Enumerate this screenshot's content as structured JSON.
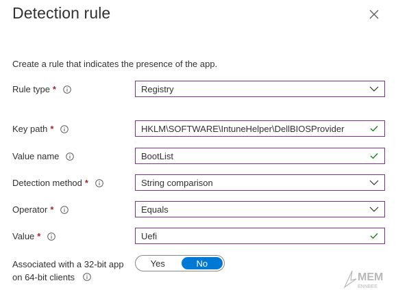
{
  "panel": {
    "title": "Detection rule",
    "description": "Create a rule that indicates the presence of the app."
  },
  "fields": {
    "rule_type": {
      "label": "Rule type",
      "value": "Registry",
      "required": true
    },
    "key_path": {
      "label": "Key path",
      "value": "HKLM\\SOFTWARE\\IntuneHelper\\DellBIOSProvider",
      "required": true
    },
    "value_name": {
      "label": "Value name",
      "value": "BootList",
      "required": false
    },
    "detection_method": {
      "label": "Detection method",
      "value": "String comparison",
      "required": true
    },
    "operator": {
      "label": "Operator",
      "value": "Equals",
      "required": true
    },
    "value": {
      "label": "Value",
      "value": "Uefi",
      "required": true
    }
  },
  "associated": {
    "label_line1": "Associated with a 32-bit app",
    "label_line2": "on 64-bit clients",
    "options": [
      "Yes",
      "No"
    ],
    "selected": "No"
  },
  "required_marker": "*",
  "watermark": {
    "text_main": "MEM",
    "text_sub": "ENNBEE"
  },
  "colors": {
    "accent": "#0078d4",
    "field_border": "#7c3086",
    "required": "#a4262c",
    "valid_check": "#107c10"
  },
  "icons": {
    "close": "close-icon",
    "info": "info-icon",
    "dropdown": "chevron-down-icon",
    "valid": "checkmark-icon"
  }
}
